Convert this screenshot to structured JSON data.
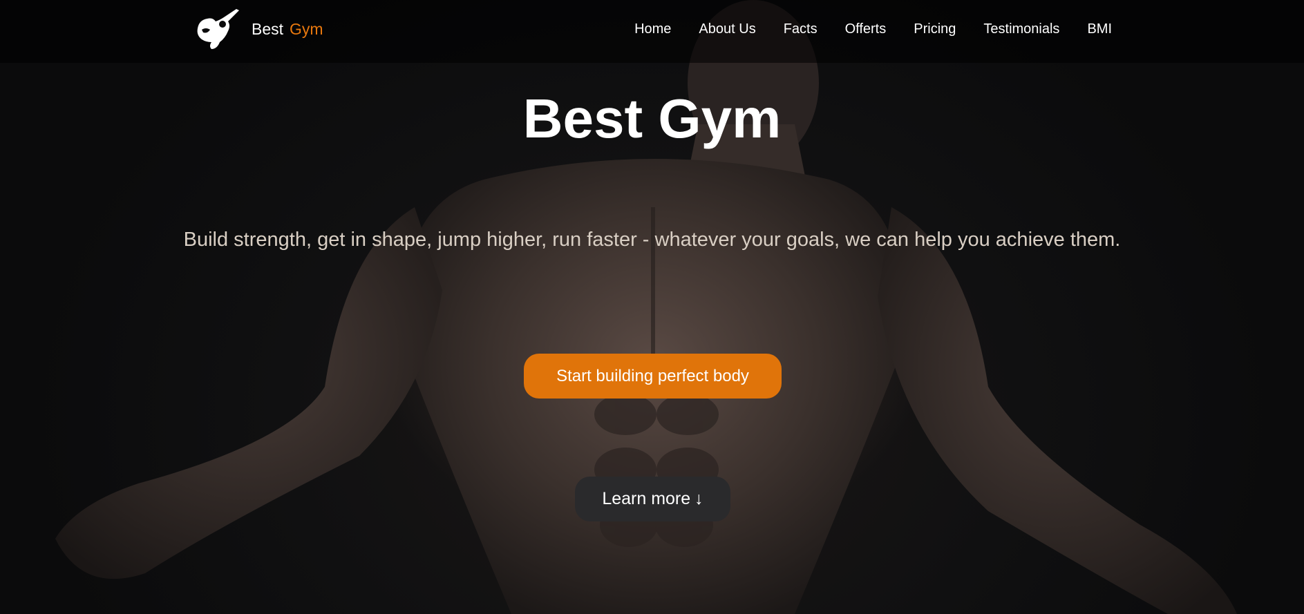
{
  "brand": {
    "first": "Best",
    "second": "Gym",
    "logo_icon": "muscle-athlete-icon",
    "accent_color": "#e8780e"
  },
  "nav": {
    "items": [
      {
        "label": "Home"
      },
      {
        "label": "About Us"
      },
      {
        "label": "Facts"
      },
      {
        "label": "Offerts"
      },
      {
        "label": "Pricing"
      },
      {
        "label": "Testimonials"
      },
      {
        "label": "BMI"
      }
    ]
  },
  "hero": {
    "title": "Best Gym",
    "subtitle": "Build strength, get in shape, jump higher, run faster - whatever your goals, we can help you achieve them.",
    "cta_label": "Start building perfect body",
    "cta_color": "#e0740a",
    "learn_label": "Learn more",
    "learn_icon": "arrow-down-icon",
    "learn_arrow": "↓"
  }
}
